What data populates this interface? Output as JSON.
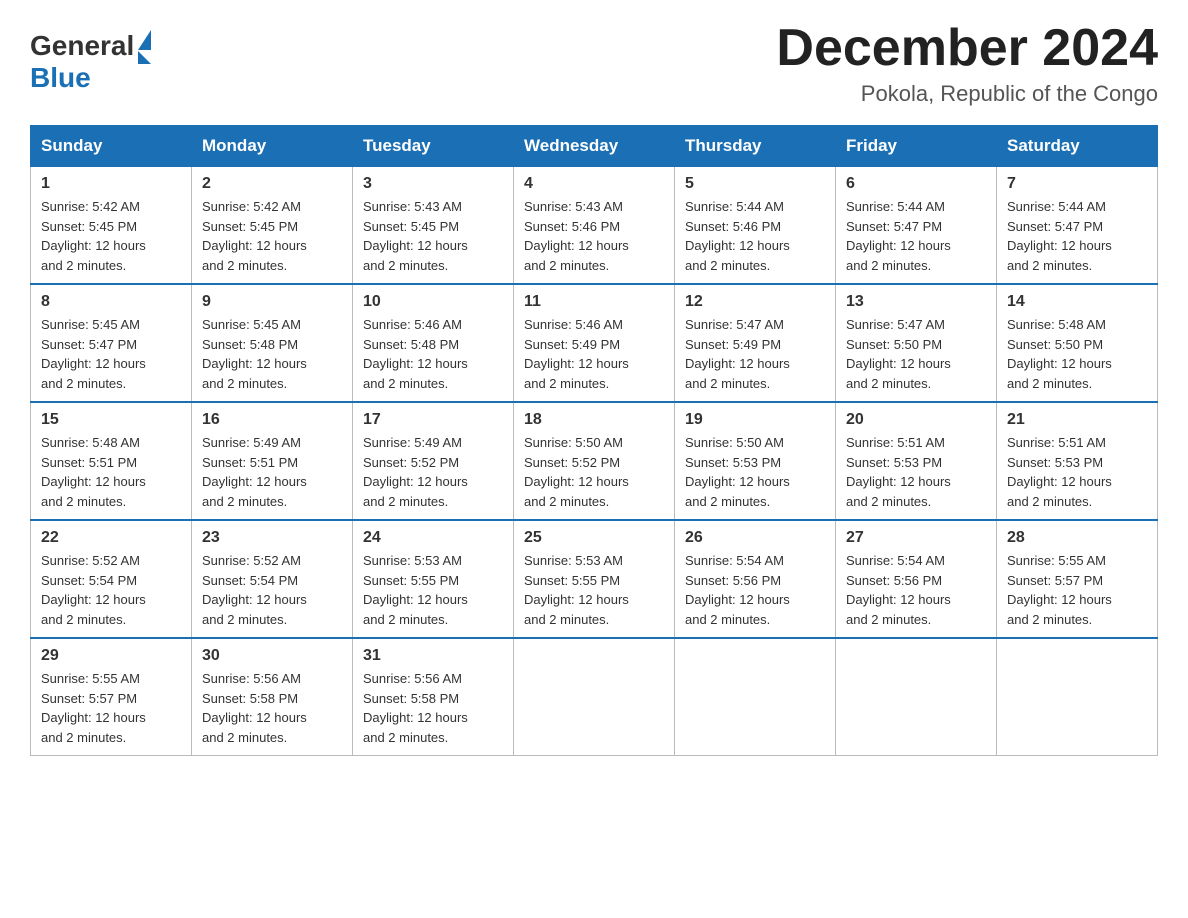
{
  "header": {
    "logo_general": "General",
    "logo_blue": "Blue",
    "month_title": "December 2024",
    "location": "Pokola, Republic of the Congo"
  },
  "days_of_week": [
    "Sunday",
    "Monday",
    "Tuesday",
    "Wednesday",
    "Thursday",
    "Friday",
    "Saturday"
  ],
  "weeks": [
    [
      {
        "day": "1",
        "sunrise": "5:42 AM",
        "sunset": "5:45 PM",
        "daylight": "12 hours and 2 minutes."
      },
      {
        "day": "2",
        "sunrise": "5:42 AM",
        "sunset": "5:45 PM",
        "daylight": "12 hours and 2 minutes."
      },
      {
        "day": "3",
        "sunrise": "5:43 AM",
        "sunset": "5:45 PM",
        "daylight": "12 hours and 2 minutes."
      },
      {
        "day": "4",
        "sunrise": "5:43 AM",
        "sunset": "5:46 PM",
        "daylight": "12 hours and 2 minutes."
      },
      {
        "day": "5",
        "sunrise": "5:44 AM",
        "sunset": "5:46 PM",
        "daylight": "12 hours and 2 minutes."
      },
      {
        "day": "6",
        "sunrise": "5:44 AM",
        "sunset": "5:47 PM",
        "daylight": "12 hours and 2 minutes."
      },
      {
        "day": "7",
        "sunrise": "5:44 AM",
        "sunset": "5:47 PM",
        "daylight": "12 hours and 2 minutes."
      }
    ],
    [
      {
        "day": "8",
        "sunrise": "5:45 AM",
        "sunset": "5:47 PM",
        "daylight": "12 hours and 2 minutes."
      },
      {
        "day": "9",
        "sunrise": "5:45 AM",
        "sunset": "5:48 PM",
        "daylight": "12 hours and 2 minutes."
      },
      {
        "day": "10",
        "sunrise": "5:46 AM",
        "sunset": "5:48 PM",
        "daylight": "12 hours and 2 minutes."
      },
      {
        "day": "11",
        "sunrise": "5:46 AM",
        "sunset": "5:49 PM",
        "daylight": "12 hours and 2 minutes."
      },
      {
        "day": "12",
        "sunrise": "5:47 AM",
        "sunset": "5:49 PM",
        "daylight": "12 hours and 2 minutes."
      },
      {
        "day": "13",
        "sunrise": "5:47 AM",
        "sunset": "5:50 PM",
        "daylight": "12 hours and 2 minutes."
      },
      {
        "day": "14",
        "sunrise": "5:48 AM",
        "sunset": "5:50 PM",
        "daylight": "12 hours and 2 minutes."
      }
    ],
    [
      {
        "day": "15",
        "sunrise": "5:48 AM",
        "sunset": "5:51 PM",
        "daylight": "12 hours and 2 minutes."
      },
      {
        "day": "16",
        "sunrise": "5:49 AM",
        "sunset": "5:51 PM",
        "daylight": "12 hours and 2 minutes."
      },
      {
        "day": "17",
        "sunrise": "5:49 AM",
        "sunset": "5:52 PM",
        "daylight": "12 hours and 2 minutes."
      },
      {
        "day": "18",
        "sunrise": "5:50 AM",
        "sunset": "5:52 PM",
        "daylight": "12 hours and 2 minutes."
      },
      {
        "day": "19",
        "sunrise": "5:50 AM",
        "sunset": "5:53 PM",
        "daylight": "12 hours and 2 minutes."
      },
      {
        "day": "20",
        "sunrise": "5:51 AM",
        "sunset": "5:53 PM",
        "daylight": "12 hours and 2 minutes."
      },
      {
        "day": "21",
        "sunrise": "5:51 AM",
        "sunset": "5:53 PM",
        "daylight": "12 hours and 2 minutes."
      }
    ],
    [
      {
        "day": "22",
        "sunrise": "5:52 AM",
        "sunset": "5:54 PM",
        "daylight": "12 hours and 2 minutes."
      },
      {
        "day": "23",
        "sunrise": "5:52 AM",
        "sunset": "5:54 PM",
        "daylight": "12 hours and 2 minutes."
      },
      {
        "day": "24",
        "sunrise": "5:53 AM",
        "sunset": "5:55 PM",
        "daylight": "12 hours and 2 minutes."
      },
      {
        "day": "25",
        "sunrise": "5:53 AM",
        "sunset": "5:55 PM",
        "daylight": "12 hours and 2 minutes."
      },
      {
        "day": "26",
        "sunrise": "5:54 AM",
        "sunset": "5:56 PM",
        "daylight": "12 hours and 2 minutes."
      },
      {
        "day": "27",
        "sunrise": "5:54 AM",
        "sunset": "5:56 PM",
        "daylight": "12 hours and 2 minutes."
      },
      {
        "day": "28",
        "sunrise": "5:55 AM",
        "sunset": "5:57 PM",
        "daylight": "12 hours and 2 minutes."
      }
    ],
    [
      {
        "day": "29",
        "sunrise": "5:55 AM",
        "sunset": "5:57 PM",
        "daylight": "12 hours and 2 minutes."
      },
      {
        "day": "30",
        "sunrise": "5:56 AM",
        "sunset": "5:58 PM",
        "daylight": "12 hours and 2 minutes."
      },
      {
        "day": "31",
        "sunrise": "5:56 AM",
        "sunset": "5:58 PM",
        "daylight": "12 hours and 2 minutes."
      },
      null,
      null,
      null,
      null
    ]
  ],
  "labels": {
    "sunrise": "Sunrise:",
    "sunset": "Sunset:",
    "daylight": "Daylight:"
  }
}
